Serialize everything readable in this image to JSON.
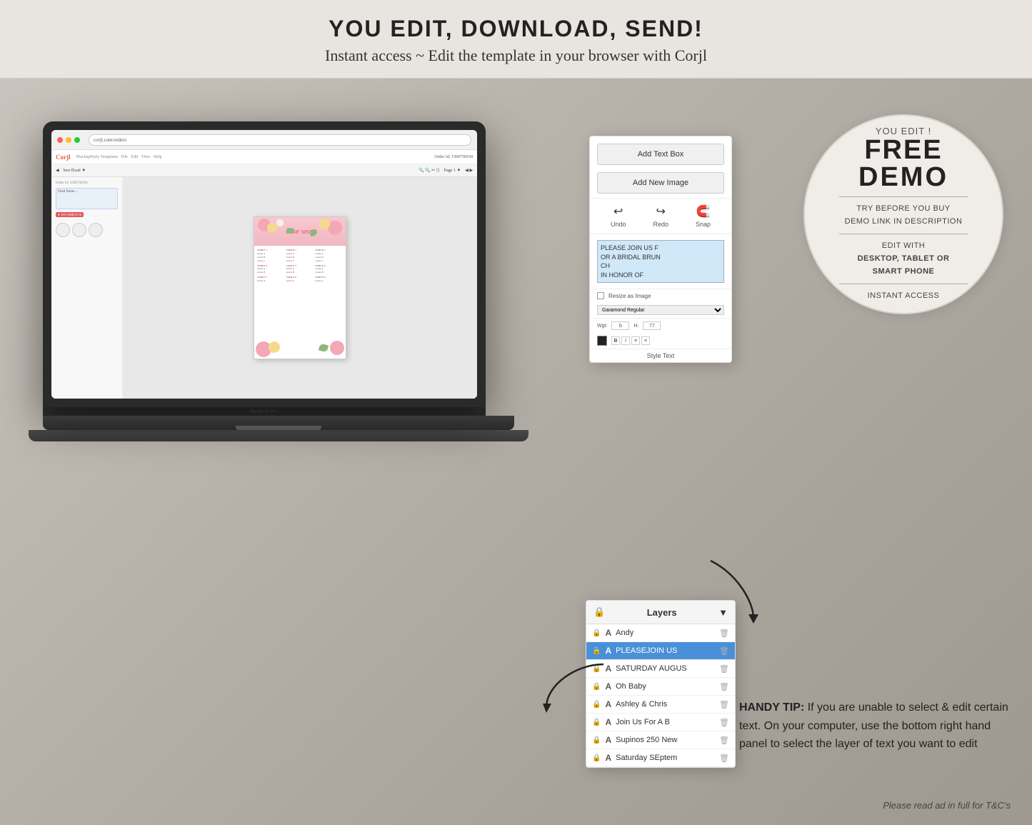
{
  "header": {
    "main_title": "YOU EDIT, DOWNLOAD, SEND!",
    "sub_title": "Instant access ~ Edit the template in your browser with Corjl"
  },
  "browser": {
    "url_text": "corjl.com/orders",
    "app_name": "Corjl",
    "order_id": "Order Id: 1500758194",
    "incomplete_label": "INCOMPLETE"
  },
  "seating_chart": {
    "title": "take seat",
    "tables": [
      {
        "label": "TABLE 1",
        "text": "Guest names line"
      },
      {
        "label": "TABLE 2",
        "text": "Guest names line"
      },
      {
        "label": "TABLE 3",
        "text": "Guest names line"
      },
      {
        "label": "TABLE 4",
        "text": "Guest names line"
      },
      {
        "label": "TABLE 5",
        "text": "Guest names line"
      },
      {
        "label": "TABLE 6",
        "text": "Guest names line"
      },
      {
        "label": "TABLE 7",
        "text": "Guest names line"
      },
      {
        "label": "TABLE 8",
        "text": "Guest names line"
      },
      {
        "label": "TABLE 9",
        "text": "Guest names line"
      }
    ]
  },
  "corjl_panel": {
    "add_text_box_label": "Add Text Box",
    "add_new_image_label": "Add New Image",
    "undo_label": "Undo",
    "redo_label": "Redo",
    "snap_label": "Snap",
    "resize_label": "Resize as Image",
    "font_placeholder": "Garamond Regular",
    "style_text_label": "Style Text",
    "text_preview": "PLEASE JOIN US F\nOR A BRIDAL BRUN\nCH\nIN HONOR OF"
  },
  "layers_panel": {
    "title": "Layers",
    "items": [
      {
        "name": "Andy",
        "active": false
      },
      {
        "name": "PLEASEJOIN US",
        "active": true
      },
      {
        "name": "SATURDAY AUGUS",
        "active": false
      },
      {
        "name": "Oh Baby",
        "active": false
      },
      {
        "name": "Ashley & Chris",
        "active": false
      },
      {
        "name": "Join Us For A B",
        "active": false
      },
      {
        "name": "Supinos 250 New",
        "active": false
      },
      {
        "name": "Saturday SEptem",
        "active": false
      }
    ]
  },
  "demo_circle": {
    "you_edit_label": "YOU EDIT !",
    "free_label": "FREE",
    "demo_label": "DEMO",
    "line1": "TRY BEFORE YOU BUY",
    "line2": "DEMO LINK IN DESCRIPTION",
    "divider2": true,
    "line3": "EDIT WITH",
    "line4": "DESKTOP, TABLET OR",
    "line5": "SMART PHONE",
    "divider3": true,
    "line6": "INSTANT ACCESS"
  },
  "handy_tip": {
    "label": "HANDY TIP:",
    "text": "If you are unable to select & edit certain text. On your computer, use the bottom right hand panel to select the layer of text you want to edit"
  },
  "disclaimer": {
    "text": "Please read ad in full for T&C's"
  }
}
